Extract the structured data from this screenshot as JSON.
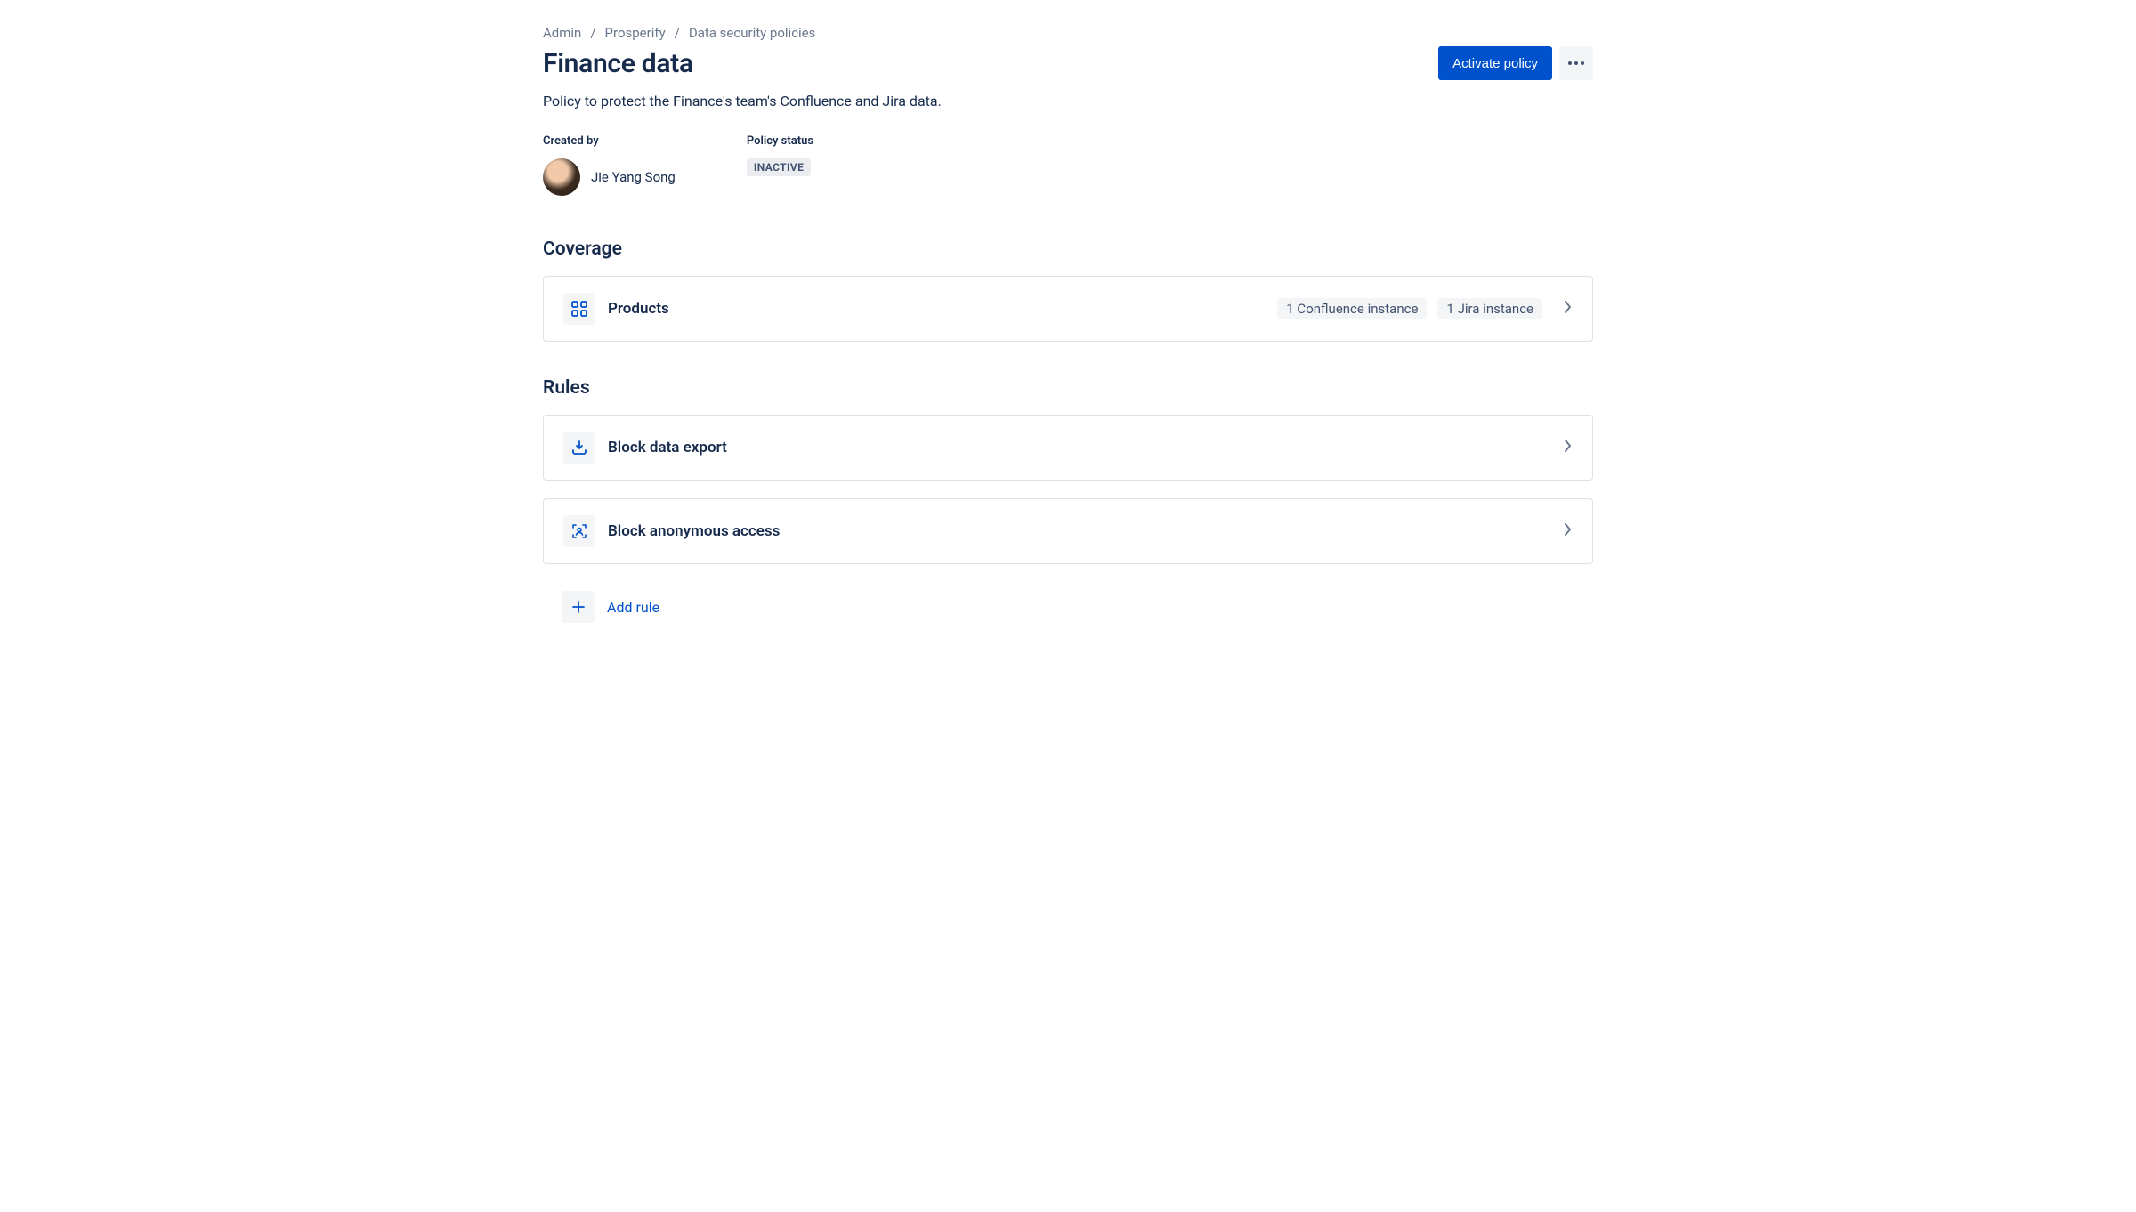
{
  "breadcrumb": {
    "items": [
      "Admin",
      "Prosperify",
      "Data security policies"
    ]
  },
  "header": {
    "title": "Finance data",
    "activate_button": "Activate policy"
  },
  "description": "Policy to protect the Finance's team's Confluence and Jira data.",
  "meta": {
    "created_by_label": "Created by",
    "created_by_name": "Jie Yang Song",
    "policy_status_label": "Policy status",
    "policy_status_value": "INACTIVE"
  },
  "sections": {
    "coverage_title": "Coverage",
    "rules_title": "Rules"
  },
  "coverage": {
    "products_label": "Products",
    "badges": [
      "1 Confluence instance",
      "1 Jira instance"
    ]
  },
  "rules": [
    {
      "label": "Block data export"
    },
    {
      "label": "Block anonymous access"
    }
  ],
  "add_rule_label": "Add rule"
}
